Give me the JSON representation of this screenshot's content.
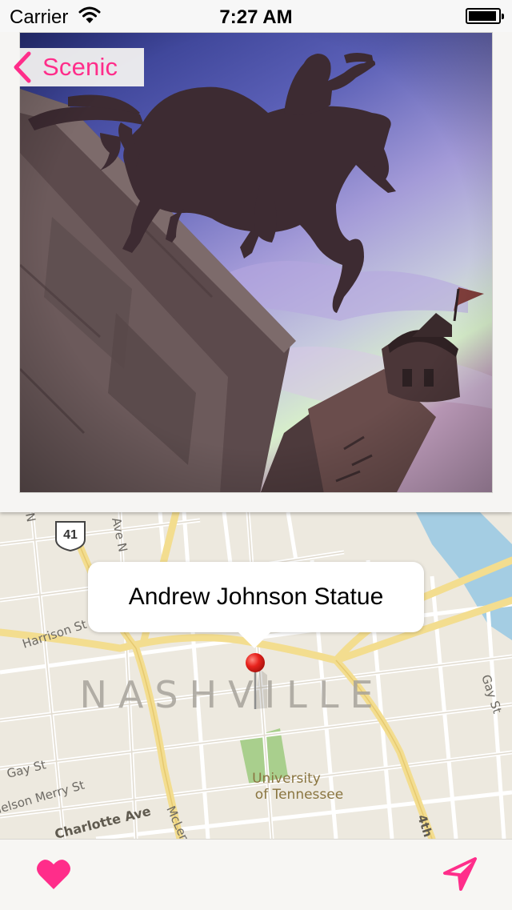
{
  "status_bar": {
    "carrier": "Carrier",
    "time": "7:27 AM",
    "battery_level": 0.95
  },
  "nav": {
    "back_label": "Scenic",
    "back_icon": "chevron-left-icon"
  },
  "photo": {
    "subject": "Andrew Johnson Statue"
  },
  "map": {
    "callout_title": "Andrew Johnson Statue",
    "city_label": "NASHVILLE",
    "labels": {
      "route_shield": "41",
      "harrison_st": "Harrison St",
      "gay_st_left": "Gay St",
      "gay_st_right": "Gay St",
      "nelson_merry_st": "Nelson Merry St",
      "charlotte_ave": "Charlotte Ave",
      "mclemore": "McLemore",
      "fourth_ave": "4th",
      "north_ave": "Ave N",
      "n_fragment": "N",
      "university": "University",
      "of_tennessee": "of Tennessee"
    }
  },
  "toolbar": {
    "favorite_icon": "heart-icon",
    "location_icon": "location-arrow-icon"
  },
  "colors": {
    "accent": "#ff2d8a",
    "pin": "#e8231d",
    "water": "#a4cde3",
    "park": "#a9cf8d",
    "arterial": "#f3dd8f"
  }
}
